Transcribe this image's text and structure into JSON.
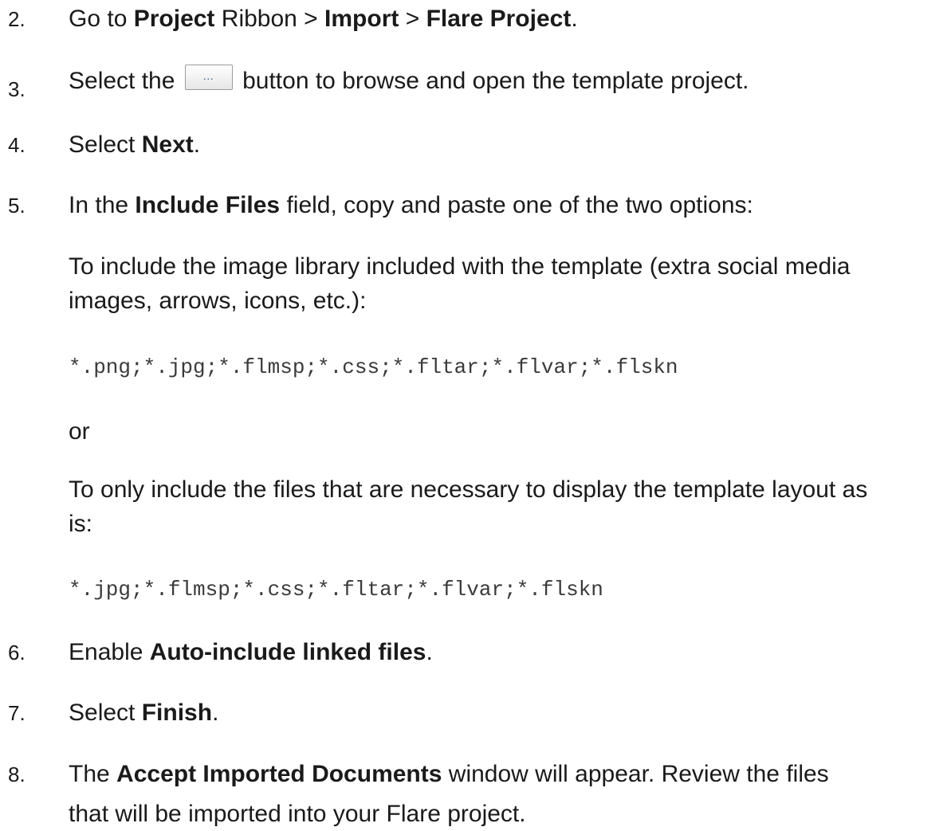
{
  "steps": [
    {
      "num": "2.",
      "pre": "Go to ",
      "b1": "Project",
      "mid1": " Ribbon > ",
      "b2": "Import",
      "mid2": " > ",
      "b3": "Flare Project",
      "post": "."
    },
    {
      "num": "3.",
      "pre": "Select the ",
      "post": " button to browse and open the template project.",
      "browse_icon": "ellipsis-icon"
    },
    {
      "num": "4.",
      "pre": "Select ",
      "b1": "Next",
      "post": "."
    },
    {
      "num": "5.",
      "pre": "In the ",
      "b1": "Include Files",
      "post": " field, copy and paste one of the two options:"
    },
    {
      "num": "6.",
      "pre": "Enable ",
      "b1": "Auto-include linked files",
      "post": "."
    },
    {
      "num": "7.",
      "pre": "Select ",
      "b1": "Finish",
      "post": "."
    },
    {
      "num": "8.",
      "pre": "The ",
      "b1": "Accept Imported Documents",
      "post": " window will appear. Review the files",
      "line2": "that will be imported into your Flare project."
    }
  ],
  "step5": {
    "option1_intro": "To include the image library included with the template (extra social media images, arrows, icons, etc.):",
    "option1_code": "*.png;*.jpg;*.flmsp;*.css;*.fltar;*.flvar;*.flskn",
    "or": "or",
    "option2_intro": "To only include the files that are necessary to display the template layout as is:",
    "option2_code": "*.jpg;*.flmsp;*.css;*.fltar;*.flvar;*.flskn"
  },
  "browse_button": {
    "glyph": "…"
  }
}
